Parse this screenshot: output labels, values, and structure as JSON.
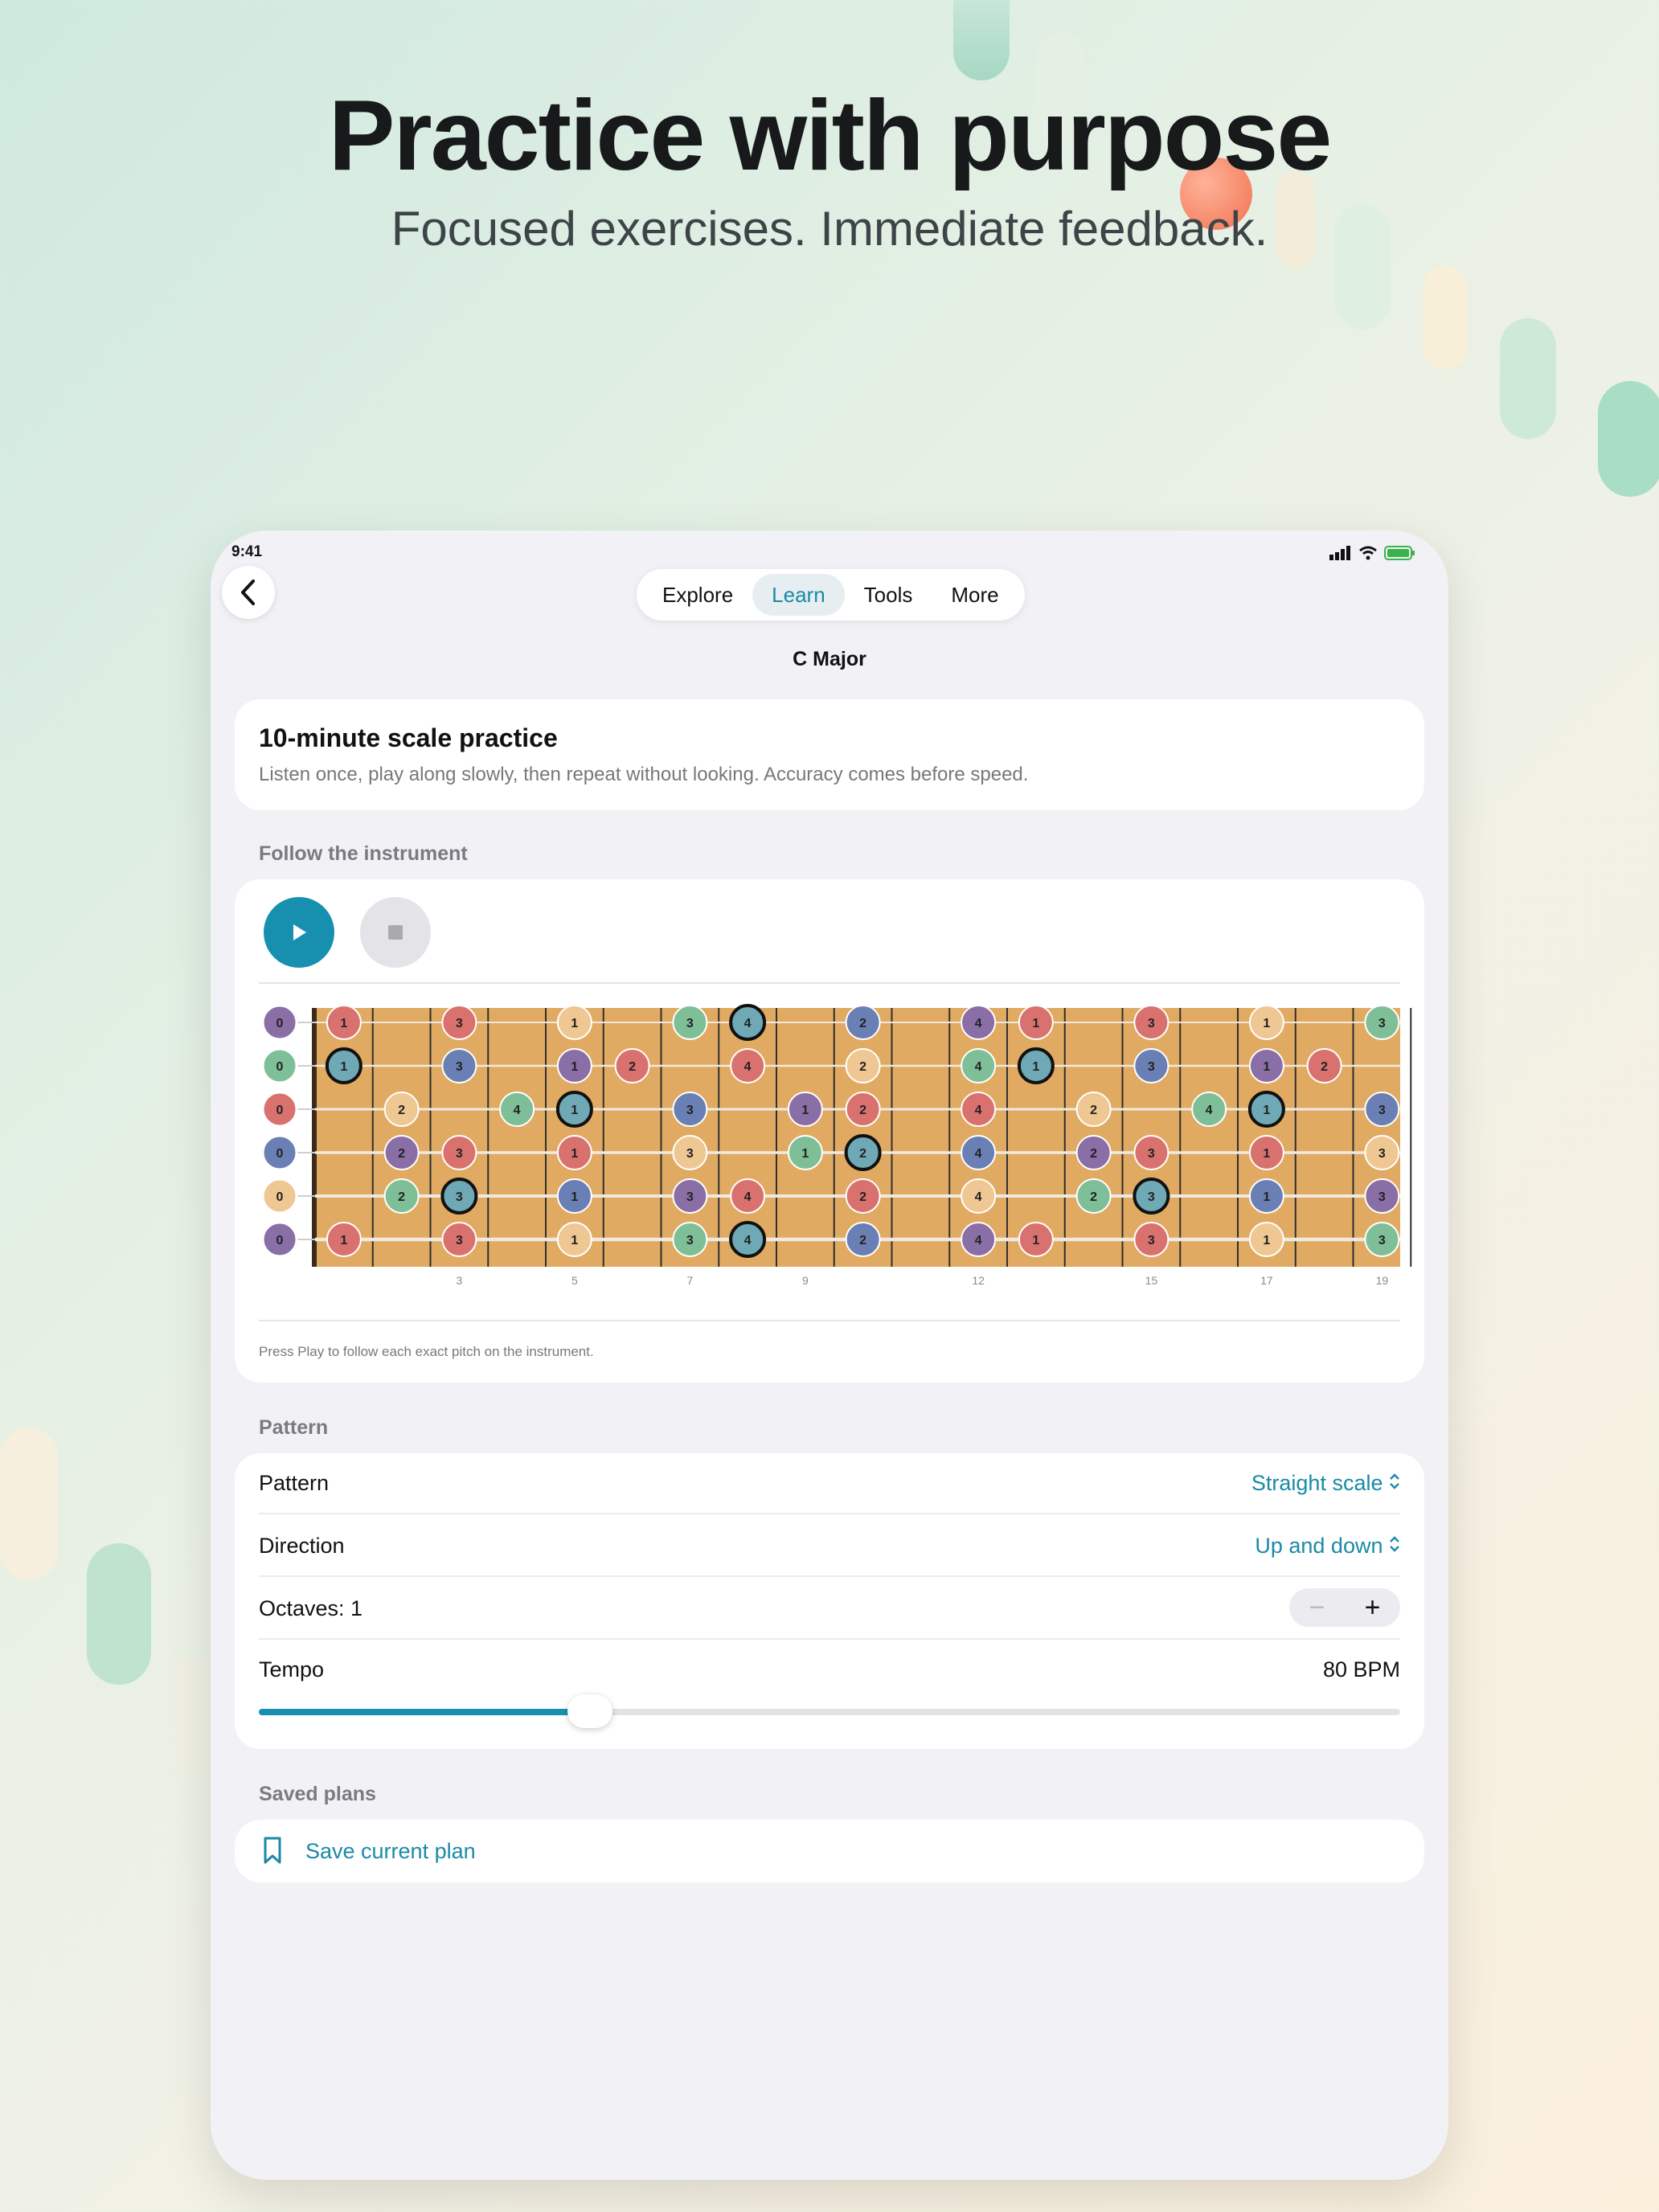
{
  "hero": {
    "title": "Practice with purpose",
    "subtitle": "Focused exercises. Immediate feedback."
  },
  "status_bar": {
    "time": "9:41"
  },
  "nav": {
    "tabs": [
      {
        "label": "Explore",
        "active": false
      },
      {
        "label": "Learn",
        "active": true
      },
      {
        "label": "Tools",
        "active": false
      },
      {
        "label": "More",
        "active": false
      }
    ],
    "title": "C Major"
  },
  "intro": {
    "title": "10-minute scale practice",
    "description": "Listen once, play along slowly, then repeat without looking. Accuracy comes before speed."
  },
  "instrument": {
    "section_label": "Follow the instrument",
    "hint": "Press Play to follow each exact pitch on the instrument.",
    "open_strings": [
      "0",
      "0",
      "0",
      "0",
      "0",
      "0"
    ],
    "fret_markers": [
      {
        "fret": 3,
        "label": "3"
      },
      {
        "fret": 5,
        "label": "5"
      },
      {
        "fret": 7,
        "label": "7"
      },
      {
        "fret": 9,
        "label": "9"
      },
      {
        "fret": 12,
        "label": "12"
      },
      {
        "fret": 15,
        "label": "15"
      },
      {
        "fret": 17,
        "label": "17"
      },
      {
        "fret": 19,
        "label": "19"
      }
    ],
    "notes": [
      {
        "s": 0,
        "f": 1,
        "d": "1",
        "c": "red"
      },
      {
        "s": 0,
        "f": 3,
        "d": "3",
        "c": "red"
      },
      {
        "s": 0,
        "f": 5,
        "d": "1",
        "c": "peach"
      },
      {
        "s": 0,
        "f": 7,
        "d": "3",
        "c": "green"
      },
      {
        "s": 0,
        "f": 8,
        "d": "4",
        "c": "teal",
        "r": true
      },
      {
        "s": 0,
        "f": 10,
        "d": "2",
        "c": "blue"
      },
      {
        "s": 0,
        "f": 12,
        "d": "4",
        "c": "purple"
      },
      {
        "s": 0,
        "f": 13,
        "d": "1",
        "c": "red"
      },
      {
        "s": 0,
        "f": 15,
        "d": "3",
        "c": "red"
      },
      {
        "s": 0,
        "f": 17,
        "d": "1",
        "c": "peach"
      },
      {
        "s": 0,
        "f": 19,
        "d": "3",
        "c": "green"
      },
      {
        "s": 1,
        "f": 1,
        "d": "1",
        "c": "teal",
        "r": true
      },
      {
        "s": 1,
        "f": 3,
        "d": "3",
        "c": "blue"
      },
      {
        "s": 1,
        "f": 5,
        "d": "1",
        "c": "purple"
      },
      {
        "s": 1,
        "f": 6,
        "d": "2",
        "c": "red"
      },
      {
        "s": 1,
        "f": 8,
        "d": "4",
        "c": "red"
      },
      {
        "s": 1,
        "f": 10,
        "d": "2",
        "c": "peach"
      },
      {
        "s": 1,
        "f": 12,
        "d": "4",
        "c": "green"
      },
      {
        "s": 1,
        "f": 13,
        "d": "1",
        "c": "teal",
        "r": true
      },
      {
        "s": 1,
        "f": 15,
        "d": "3",
        "c": "blue"
      },
      {
        "s": 1,
        "f": 17,
        "d": "1",
        "c": "purple"
      },
      {
        "s": 1,
        "f": 18,
        "d": "2",
        "c": "red"
      },
      {
        "s": 2,
        "f": 2,
        "d": "2",
        "c": "peach"
      },
      {
        "s": 2,
        "f": 4,
        "d": "4",
        "c": "green"
      },
      {
        "s": 2,
        "f": 5,
        "d": "1",
        "c": "teal",
        "r": true
      },
      {
        "s": 2,
        "f": 7,
        "d": "3",
        "c": "blue"
      },
      {
        "s": 2,
        "f": 9,
        "d": "1",
        "c": "purple"
      },
      {
        "s": 2,
        "f": 10,
        "d": "2",
        "c": "red"
      },
      {
        "s": 2,
        "f": 12,
        "d": "4",
        "c": "red"
      },
      {
        "s": 2,
        "f": 14,
        "d": "2",
        "c": "peach"
      },
      {
        "s": 2,
        "f": 16,
        "d": "4",
        "c": "green"
      },
      {
        "s": 2,
        "f": 17,
        "d": "1",
        "c": "teal",
        "r": true
      },
      {
        "s": 2,
        "f": 19,
        "d": "3",
        "c": "blue"
      },
      {
        "s": 3,
        "f": 2,
        "d": "2",
        "c": "purple"
      },
      {
        "s": 3,
        "f": 3,
        "d": "3",
        "c": "red"
      },
      {
        "s": 3,
        "f": 5,
        "d": "1",
        "c": "red"
      },
      {
        "s": 3,
        "f": 7,
        "d": "3",
        "c": "peach"
      },
      {
        "s": 3,
        "f": 9,
        "d": "1",
        "c": "green"
      },
      {
        "s": 3,
        "f": 10,
        "d": "2",
        "c": "teal",
        "r": true
      },
      {
        "s": 3,
        "f": 12,
        "d": "4",
        "c": "blue"
      },
      {
        "s": 3,
        "f": 14,
        "d": "2",
        "c": "purple"
      },
      {
        "s": 3,
        "f": 15,
        "d": "3",
        "c": "red"
      },
      {
        "s": 3,
        "f": 17,
        "d": "1",
        "c": "red"
      },
      {
        "s": 3,
        "f": 19,
        "d": "3",
        "c": "peach"
      },
      {
        "s": 4,
        "f": 2,
        "d": "2",
        "c": "green"
      },
      {
        "s": 4,
        "f": 3,
        "d": "3",
        "c": "teal",
        "r": true
      },
      {
        "s": 4,
        "f": 5,
        "d": "1",
        "c": "blue"
      },
      {
        "s": 4,
        "f": 7,
        "d": "3",
        "c": "purple"
      },
      {
        "s": 4,
        "f": 8,
        "d": "4",
        "c": "red"
      },
      {
        "s": 4,
        "f": 10,
        "d": "2",
        "c": "red"
      },
      {
        "s": 4,
        "f": 12,
        "d": "4",
        "c": "peach"
      },
      {
        "s": 4,
        "f": 14,
        "d": "2",
        "c": "green"
      },
      {
        "s": 4,
        "f": 15,
        "d": "3",
        "c": "teal",
        "r": true
      },
      {
        "s": 4,
        "f": 17,
        "d": "1",
        "c": "blue"
      },
      {
        "s": 4,
        "f": 19,
        "d": "3",
        "c": "purple"
      },
      {
        "s": 5,
        "f": 1,
        "d": "1",
        "c": "red"
      },
      {
        "s": 5,
        "f": 3,
        "d": "3",
        "c": "red"
      },
      {
        "s": 5,
        "f": 5,
        "d": "1",
        "c": "peach"
      },
      {
        "s": 5,
        "f": 7,
        "d": "3",
        "c": "green"
      },
      {
        "s": 5,
        "f": 8,
        "d": "4",
        "c": "teal",
        "r": true
      },
      {
        "s": 5,
        "f": 10,
        "d": "2",
        "c": "blue"
      },
      {
        "s": 5,
        "f": 12,
        "d": "4",
        "c": "purple"
      },
      {
        "s": 5,
        "f": 13,
        "d": "1",
        "c": "red"
      },
      {
        "s": 5,
        "f": 15,
        "d": "3",
        "c": "red"
      },
      {
        "s": 5,
        "f": 17,
        "d": "1",
        "c": "peach"
      },
      {
        "s": 5,
        "f": 19,
        "d": "3",
        "c": "green"
      }
    ],
    "open_colors": [
      "purple",
      "green",
      "red",
      "blue",
      "peach",
      "purple"
    ],
    "colors": {
      "red": "#d9726f",
      "peach": "#efc793",
      "green": "#7fbf98",
      "teal": "#6fa9b5",
      "blue": "#6a80b4",
      "purple": "#8a6ea6",
      "wood": "#e1aa62",
      "accent": "#1790b0"
    }
  },
  "pattern": {
    "section_label": "Pattern",
    "pattern_label": "Pattern",
    "pattern_value": "Straight scale",
    "direction_label": "Direction",
    "direction_value": "Up and down",
    "octaves_label": "Octaves: 1",
    "tempo_label": "Tempo",
    "tempo_value": "80 BPM",
    "tempo_fraction": 0.29
  },
  "saved": {
    "section_label": "Saved plans",
    "save_label": "Save current plan"
  }
}
